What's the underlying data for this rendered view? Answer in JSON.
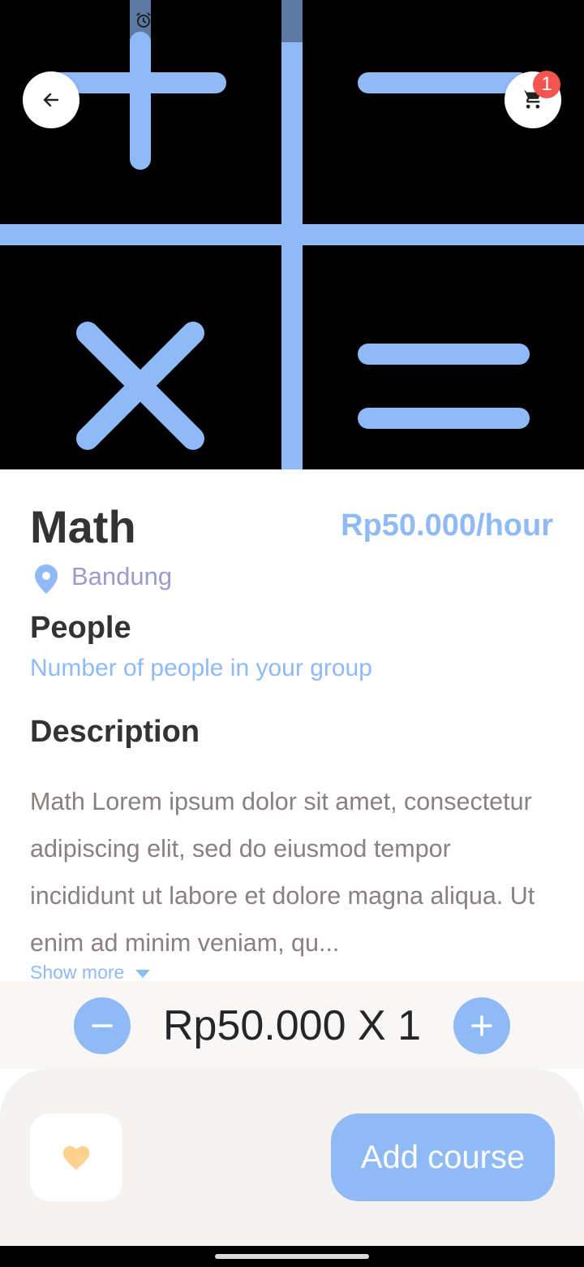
{
  "hero": {
    "image": "math-operators-illustration",
    "accent_color": "#8fbaf6"
  },
  "status_bar": {
    "icon": "alarm-icon"
  },
  "header": {
    "back_icon": "arrow-left-icon",
    "cart_icon": "cart-icon",
    "cart_badge": "1"
  },
  "course": {
    "title": "Math",
    "price": "Rp50.000/hour",
    "location": "Bandung",
    "people_heading": "People",
    "people_subtitle": "Number of people in your group",
    "description_heading": "Description",
    "description": "Math Lorem ipsum dolor sit amet, consectetur adipiscing elit, sed do eiusmod tempor incididunt ut labore et dolore magna aliqua. Ut enim ad minim veniam, qu...",
    "show_more": "Show more"
  },
  "quantity": {
    "text": "Rp50.000 X 1",
    "minus_icon": "minus-icon",
    "plus_icon": "plus-icon"
  },
  "actions": {
    "favorite_icon": "heart-icon",
    "add_label": "Add course"
  },
  "colors": {
    "primary": "#8fbaf6",
    "title": "#333333",
    "badge": "#f4544f",
    "heart": "#fdd28e"
  }
}
